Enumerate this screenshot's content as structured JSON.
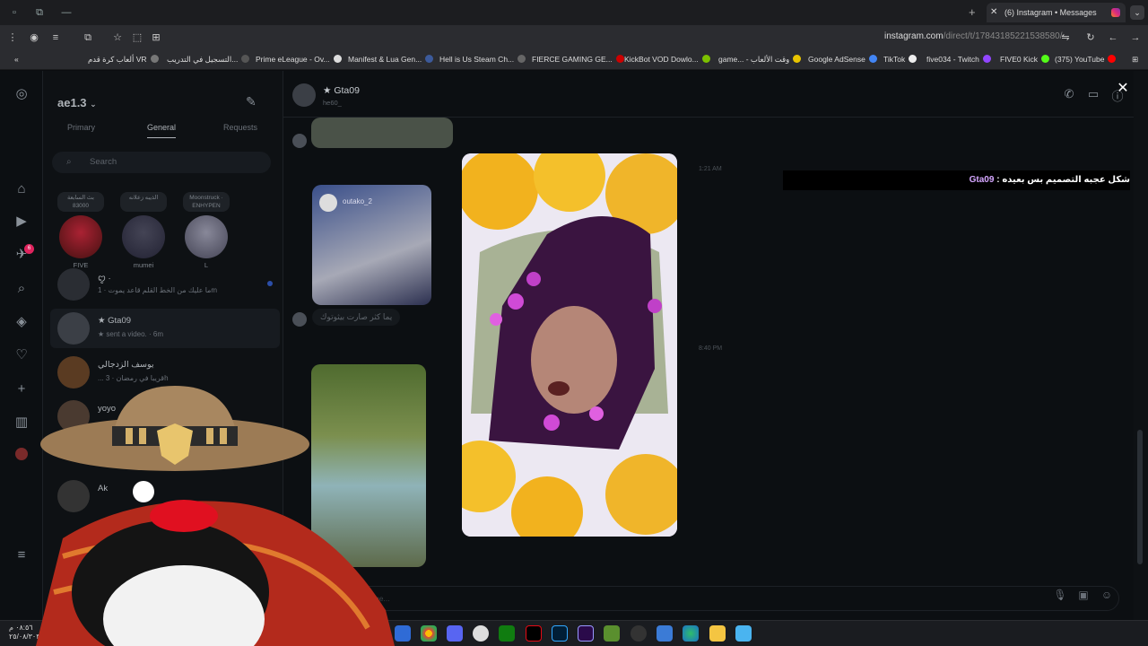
{
  "browser": {
    "tab_title": "(6) Instagram • Messages",
    "url_domain": "instagram.com",
    "url_path": "/direct/t/17843185221538580/",
    "bookmarks": [
      "ألعاب كرة قدم VR",
      "التسجيل في التدريب...",
      "Prime eLeague - Ov...",
      "Manifest & Lua Gen...",
      "Hell is Us Steam Ch...",
      "FIERCE GAMING GE...",
      "KickBot VOD Dowlo...",
      "game... - وقت الألعاب",
      "Google AdSense",
      "TikTok",
      "five034 - Twitch",
      "FIVE0 Kick",
      "(375) YouTube"
    ]
  },
  "inbox": {
    "account": "ae1.3",
    "tabs": [
      "Primary",
      "General",
      "Requests"
    ],
    "search_placeholder": "Search",
    "notes": [
      {
        "note": "بث السابعة 83000",
        "name": "FIVE"
      },
      {
        "note": "الذيبه زعلانه",
        "name": "mumei"
      },
      {
        "note": "Moonstruck · ENHYPEN",
        "name": "L"
      }
    ],
    "conversations": [
      {
        "title": "ꨄ ·",
        "preview": "ما عليك من الخط القلم قاعد يموت · 1m"
      },
      {
        "title": "★ Gta09",
        "preview": "★ sent a video. · 6m"
      },
      {
        "title": "يوسف الزدجالي",
        "preview": "... قريبا في رمضان · 3h"
      },
      {
        "title": "yoyo",
        "preview": ""
      },
      {
        "title": "Ak",
        "preview": ""
      }
    ]
  },
  "chat": {
    "name": "★ Gta09",
    "sub": "he60_",
    "shared_post_user": "outako_2",
    "message_1": "يما كثر صارت بيثوتوك",
    "time_1": "1:21 AM",
    "time_2": "8:40 PM",
    "input_placeholder": "Message..."
  },
  "overlay": {
    "caption_user": "Gta09",
    "caption_text": "شكل عجبه التصميم بس بعيده :"
  },
  "taskbar": {
    "clock_time": "٠٨:٥٦ م",
    "clock_date": "٢٥/٠٨/٣٠٣"
  },
  "colors": {
    "bg": "#0c0f12",
    "accent_notif": "#e0245e",
    "caption_user": "#d5a6ff"
  }
}
